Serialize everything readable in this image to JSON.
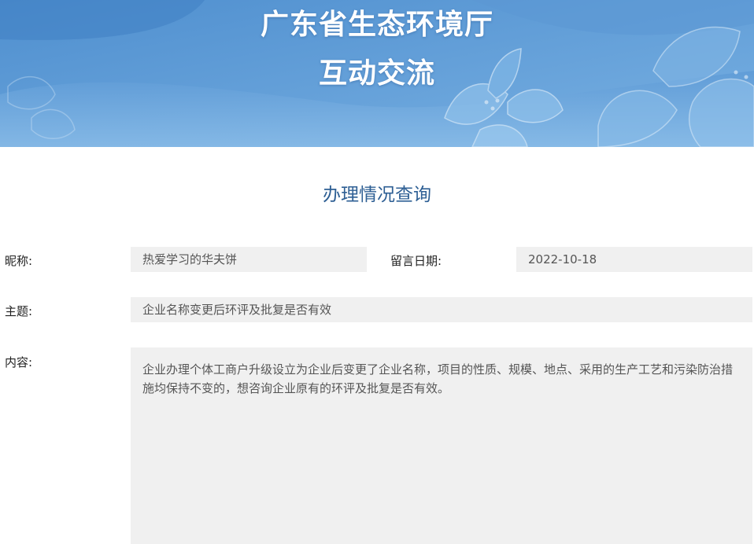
{
  "banner": {
    "title_line1": "广东省生态环境厅",
    "title_line2": "互动交流"
  },
  "section_title": "办理情况查询",
  "form": {
    "nickname_label": "昵称:",
    "nickname_value": "热爱学习的华夫饼",
    "date_label": "留言日期:",
    "date_value": "2022-10-18",
    "subject_label": "主题:",
    "subject_value": "企业名称变更后环评及批复是否有效",
    "content_label": "内容:",
    "content_value": "企业办理个体工商户升级设立为企业后变更了企业名称，项目的性质、规模、地点、采用的生产工艺和污染防治措施均保持不变的，想咨询企业原有的环评及批复是否有效。"
  },
  "colors": {
    "banner_blue": "#6fa7dc",
    "title_blue": "#2e5f94",
    "field_bg": "#f0f0f0"
  }
}
